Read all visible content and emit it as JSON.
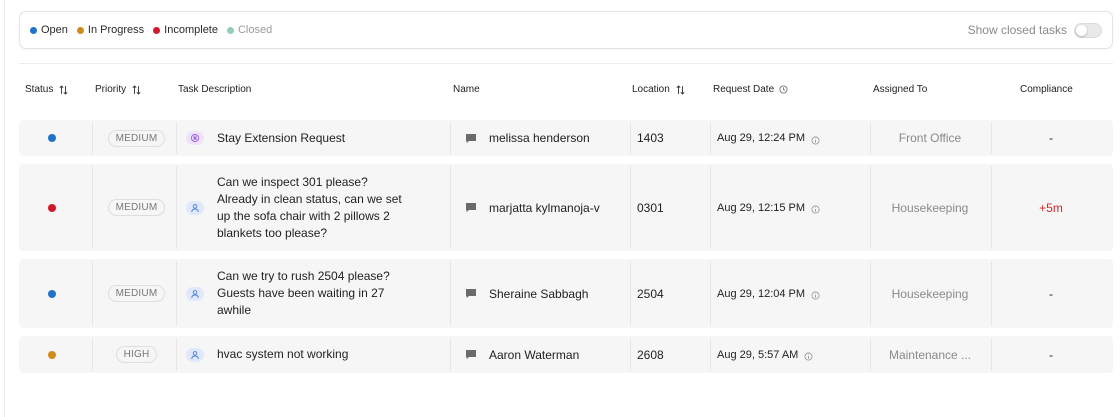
{
  "legend": [
    {
      "label": "Open",
      "color": "#1e73c8",
      "muted": false
    },
    {
      "label": "In Progress",
      "color": "#d08b1b",
      "muted": false
    },
    {
      "label": "Incomplete",
      "color": "#d0192a",
      "muted": false
    },
    {
      "label": "Closed",
      "color": "#8fcfb4",
      "muted": true
    }
  ],
  "toggle": {
    "label": "Show closed tasks",
    "on": false
  },
  "columns": {
    "status": "Status",
    "priority": "Priority",
    "task": "Task Description",
    "name": "Name",
    "location": "Location",
    "request_date": "Request Date",
    "assigned": "Assigned To",
    "compliance": "Compliance"
  },
  "rows": [
    {
      "status_color": "#1e73c8",
      "priority": "MEDIUM",
      "task_icon": "sparkle-icon",
      "task_icon_tone": "purple",
      "task": "Stay Extension Request",
      "name": "melissa henderson",
      "location": "1403",
      "date": "Aug 29, 12:24 PM",
      "assigned": "Front Office",
      "compliance": "-",
      "compliance_alert": false
    },
    {
      "status_color": "#d0192a",
      "priority": "MEDIUM",
      "task_icon": "person-icon",
      "task_icon_tone": "blue",
      "task": "Can we inspect 301 please? Already in clean status, can we set up the sofa chair with 2 pillows 2 blankets too please?",
      "name": "marjatta kylmanoja-v",
      "location": "0301",
      "date": "Aug 29, 12:15 PM",
      "assigned": "Housekeeping",
      "compliance": "+5m",
      "compliance_alert": true
    },
    {
      "status_color": "#1e73c8",
      "priority": "MEDIUM",
      "task_icon": "person-icon",
      "task_icon_tone": "blue",
      "task": "Can we try to rush 2504 please? Guests have been waiting in 27 awhile",
      "name": "Sheraine Sabbagh",
      "location": "2504",
      "date": "Aug 29, 12:04 PM",
      "assigned": "Housekeeping",
      "compliance": "-",
      "compliance_alert": false
    },
    {
      "status_color": "#d08b1b",
      "priority": "HIGH",
      "task_icon": "person-icon",
      "task_icon_tone": "blue",
      "task": "hvac system not working",
      "name": "Aaron Waterman",
      "location": "2608",
      "date": "Aug 29, 5:57 AM",
      "assigned": "Maintenance ...",
      "compliance": "-",
      "compliance_alert": false
    }
  ]
}
